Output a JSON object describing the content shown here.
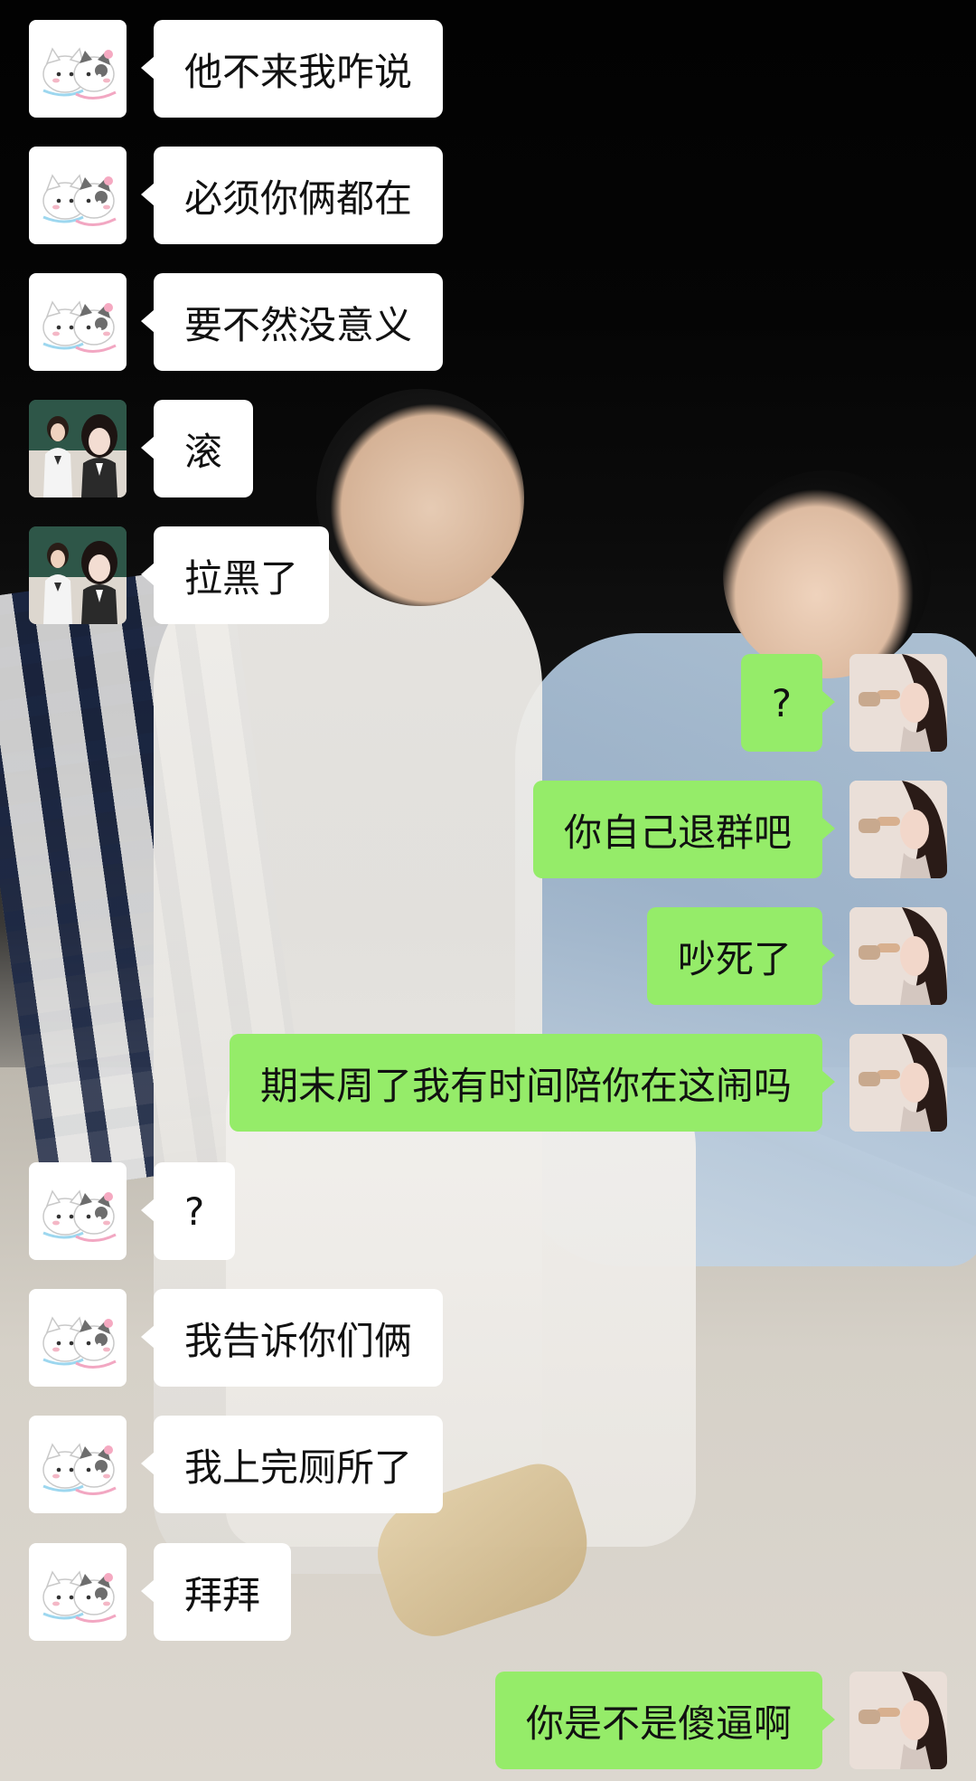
{
  "messages": [
    {
      "side": "left",
      "avatar": "cat-sticker-avatar",
      "text": "他不来我咋说"
    },
    {
      "side": "left",
      "avatar": "cat-sticker-avatar",
      "text": "必须你俩都在"
    },
    {
      "side": "left",
      "avatar": "cat-sticker-avatar",
      "text": "要不然没意义"
    },
    {
      "side": "left",
      "avatar": "two-girls-avatar",
      "text": "滚"
    },
    {
      "side": "left",
      "avatar": "two-girls-avatar",
      "text": "拉黑了"
    },
    {
      "side": "right",
      "avatar": "self-avatar",
      "text": "?"
    },
    {
      "side": "right",
      "avatar": "self-avatar",
      "text": "你自己退群吧"
    },
    {
      "side": "right",
      "avatar": "self-avatar",
      "text": "吵死了"
    },
    {
      "side": "right",
      "avatar": "self-avatar",
      "text": "期末周了我有时间陪你在这闹吗"
    },
    {
      "side": "left",
      "avatar": "cat-sticker-avatar",
      "text": "?"
    },
    {
      "side": "left",
      "avatar": "cat-sticker-avatar",
      "text": "我告诉你们俩"
    },
    {
      "side": "left",
      "avatar": "cat-sticker-avatar",
      "text": "我上完厕所了"
    },
    {
      "side": "left",
      "avatar": "cat-sticker-avatar",
      "text": "拜拜"
    },
    {
      "side": "right",
      "avatar": "self-avatar",
      "text": "你是不是傻逼啊"
    }
  ],
  "colors": {
    "incoming_bubble": "#ffffff",
    "outgoing_bubble": "#95ec69",
    "text": "#111111"
  }
}
